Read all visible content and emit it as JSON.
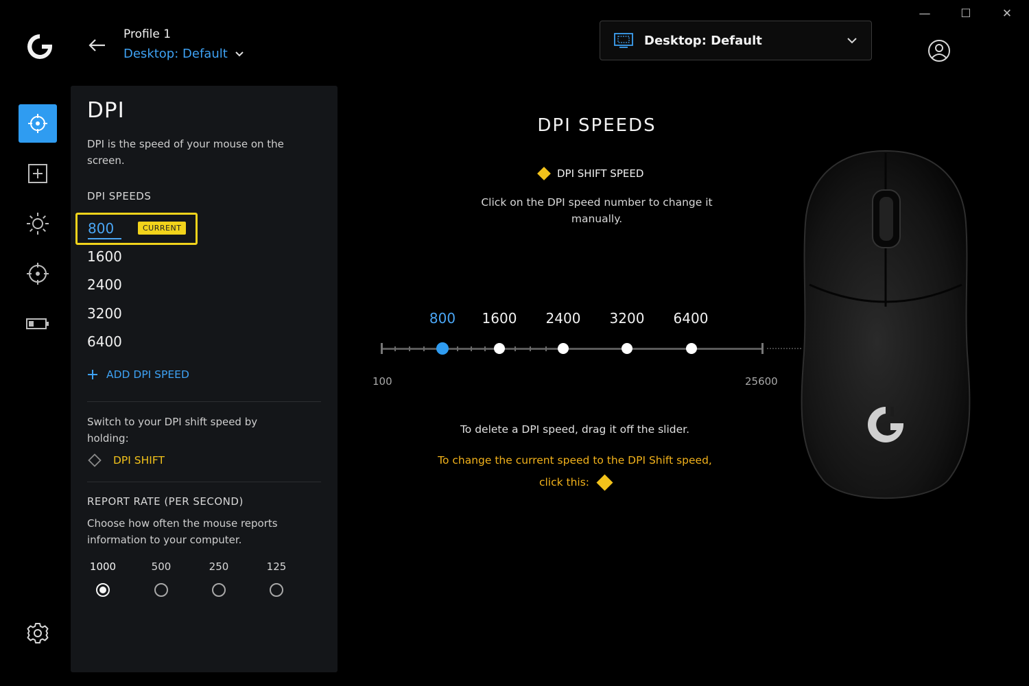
{
  "window": {
    "minimize_icon": "minimize-icon",
    "maximize_icon": "maximize-icon",
    "close_icon": "close-icon"
  },
  "header": {
    "profile_name": "Profile 1",
    "profile_mode": "Desktop: Default",
    "dropdown_label": "Desktop: Default"
  },
  "rail": {
    "items": [
      "dpi-sensitivity-icon",
      "assignments-plus-icon",
      "lighting-sun-icon",
      "sensor-crosshair-icon",
      "battery-icon"
    ],
    "settings": "gear-icon"
  },
  "panel": {
    "title": "DPI",
    "description": "DPI is the speed of your mouse on the screen.",
    "dpi_speeds_title": "DPI SPEEDS",
    "current_badge": "CURRENT",
    "dpi_values": [
      "800",
      "1600",
      "2400",
      "3200",
      "6400"
    ],
    "add_dpi_label": "ADD DPI SPEED",
    "shift_description": "Switch to your DPI shift speed by holding:",
    "shift_label": "DPI SHIFT",
    "report_rate_title": "REPORT RATE (PER SECOND)",
    "report_rate_description": "Choose how often the mouse reports information to your computer.",
    "report_rates": [
      "1000",
      "500",
      "250",
      "125"
    ],
    "report_rate_selected": "1000"
  },
  "main": {
    "title": "DPI SPEEDS",
    "shift_speed_legend": "DPI SHIFT SPEED",
    "click_hint": "Click on the DPI speed number to change it manually.",
    "slider_min": "100",
    "slider_max": "25600",
    "slider_values": [
      "800",
      "1600",
      "2400",
      "3200",
      "6400"
    ],
    "current_value": "800",
    "delete_hint": "To delete a DPI speed, drag it off the slider.",
    "change_hint_line1": "To change the current speed to the DPI Shift speed,",
    "change_hint_line2": "click this:"
  },
  "colors": {
    "accent": "#2f9cf1",
    "highlight": "#f2d31b",
    "shift": "#f2c21b",
    "panel": "#141619"
  }
}
